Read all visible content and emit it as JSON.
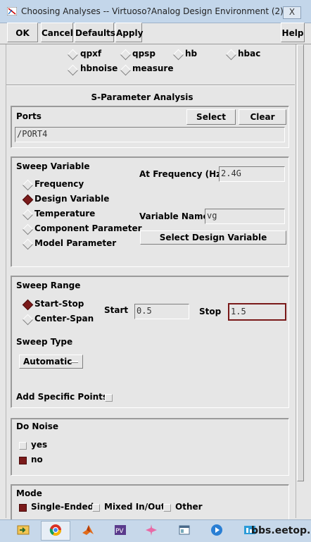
{
  "window": {
    "title": "Choosing Analyses -- Virtuoso?Analog Design Environment (2)",
    "close_label": "X"
  },
  "toolbar": {
    "ok": "OK",
    "cancel": "Cancel",
    "defaults": "Defaults",
    "apply": "Apply",
    "help": "Help"
  },
  "analyses": {
    "row1": [
      "qpxf",
      "qpsp",
      "hb",
      "hbac"
    ],
    "row2": [
      "hbnoise",
      "measure"
    ]
  },
  "section_title": "S-Parameter Analysis",
  "ports": {
    "label": "Ports",
    "select": "Select",
    "clear": "Clear",
    "value": "/PORT4"
  },
  "sweep_variable": {
    "label": "Sweep Variable",
    "options": [
      "Frequency",
      "Design Variable",
      "Temperature",
      "Component Parameter",
      "Model Parameter"
    ],
    "selected": "Design Variable",
    "at_frequency_label": "At Frequency (Hz)",
    "at_frequency_value": "2.4G",
    "variable_name_label": "Variable Name",
    "variable_name_value": "vg",
    "select_design_variable": "Select Design Variable"
  },
  "sweep_range": {
    "label": "Sweep Range",
    "options": [
      "Start-Stop",
      "Center-Span"
    ],
    "selected": "Start-Stop",
    "start_label": "Start",
    "start_value": "0.5",
    "stop_label": "Stop",
    "stop_value": "1.5"
  },
  "sweep_type": {
    "label": "Sweep Type",
    "value": "Automatic"
  },
  "add_specific_points": {
    "label": "Add Specific Points",
    "checked": false
  },
  "do_noise": {
    "label": "Do Noise",
    "options": [
      "yes",
      "no"
    ],
    "selected": "no"
  },
  "mode": {
    "label": "Mode",
    "options": [
      "Single-Ended",
      "Mixed In/Out",
      "Other"
    ],
    "selected": "Single-Ended"
  },
  "watermark": "bbs.eetop.cn",
  "colors": {
    "selected": "#7a1a1a",
    "background": "#e6e6e6",
    "titlebar": "#c3d6ea"
  },
  "taskbar_icons": [
    "explorer-icon",
    "chrome-icon",
    "matlab-icon",
    "pspice-icon",
    "flower-app-icon",
    "window-app-icon",
    "media-player-icon",
    "network-app-icon"
  ]
}
